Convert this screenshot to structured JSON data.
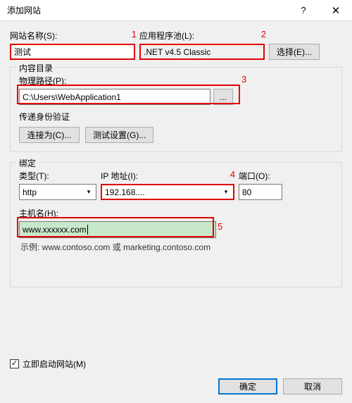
{
  "title": "添加网站",
  "help_icon": "?",
  "close_icon": "✕",
  "site_name_label": "网站名称(S):",
  "site_name_value": "测试",
  "app_pool_label": "应用程序池(L):",
  "app_pool_value": ".NET v4.5 Classic",
  "select_button": "选择(E)...",
  "content_dir_legend": "内容目录",
  "physical_path_label": "物理路径(P):",
  "physical_path_value": "C:\\Users\\WebApplication1",
  "browse_button": "...",
  "auth_label": "传递身份验证",
  "connect_as_button": "连接为(C)...",
  "test_settings_button": "测试设置(G)...",
  "binding_legend": "绑定",
  "type_label": "类型(T):",
  "type_value": "http",
  "ip_label": "IP 地址(I):",
  "ip_value": "192.168....",
  "port_label": "端口(O):",
  "port_value": "80",
  "host_label": "主机名(H):",
  "host_value": "www.xxxxxx.com",
  "example_text": "示例: www.contoso.com 或 marketing.contoso.com",
  "start_site_label": "立即启动网站(M)",
  "start_site_check": "✓",
  "ok_button": "确定",
  "cancel_button": "取消",
  "anno_1": "1",
  "anno_2": "2",
  "anno_3": "3",
  "anno_4": "4",
  "anno_5": "5"
}
